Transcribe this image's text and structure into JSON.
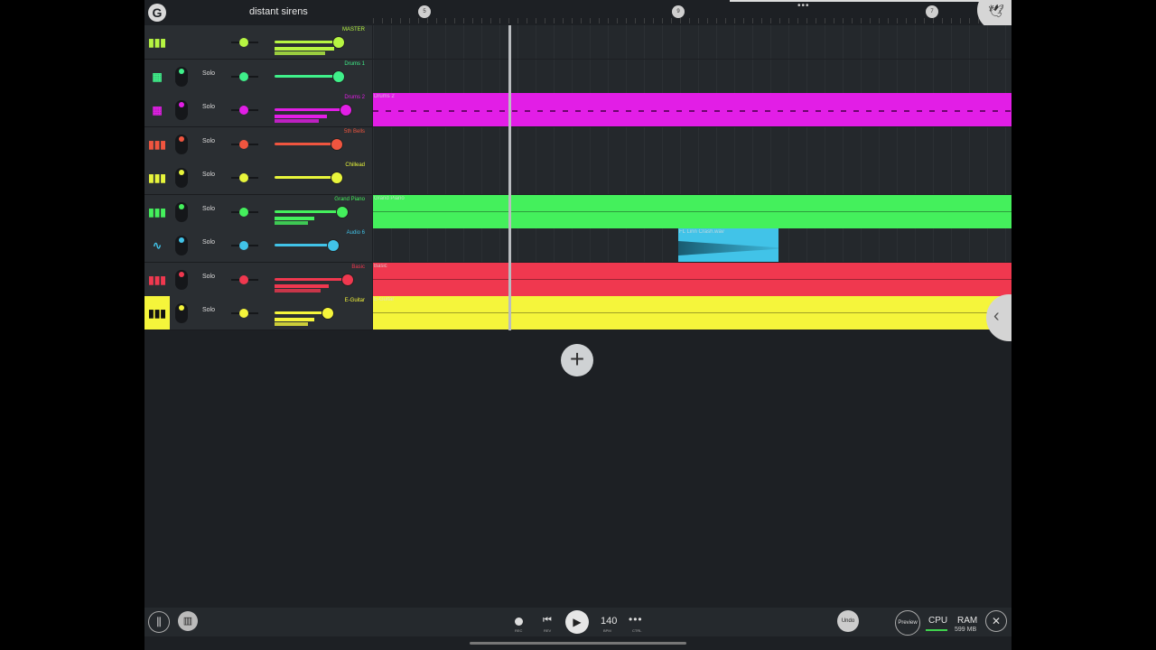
{
  "project": {
    "title": "distant sirens"
  },
  "ruler": {
    "markers": [
      "5",
      "9",
      "7"
    ],
    "more": "•••"
  },
  "tracks": [
    {
      "name": "MASTER",
      "solo": "",
      "color": "#b6f542",
      "icon": "mixer-bars-icon",
      "glyph": "▮▮▮",
      "volume": 0.88,
      "meter": 0.82
    },
    {
      "name": "Drums 1",
      "solo": "Solo",
      "color": "#3ff08a",
      "icon": "drum-grid-icon",
      "glyph": "▦",
      "volume": 0.88,
      "meter": 0.0
    },
    {
      "name": "Drums 2",
      "solo": "Solo",
      "color": "#e21ee6",
      "icon": "drum-grid-icon",
      "glyph": "▦",
      "volume": 0.98,
      "meter": 0.72
    },
    {
      "name": "5th Bells",
      "solo": "Solo",
      "color": "#f0553f",
      "icon": "keys-icon",
      "glyph": "▮▮▮",
      "volume": 0.85,
      "meter": 0.0
    },
    {
      "name": "Chillead",
      "solo": "Solo",
      "color": "#e8f53b",
      "icon": "keys-icon",
      "glyph": "▮▮▮",
      "volume": 0.85,
      "meter": 0.0
    },
    {
      "name": "Grand Piano",
      "solo": "Solo",
      "color": "#44f05c",
      "icon": "keys-icon",
      "glyph": "▮▮▮",
      "volume": 0.93,
      "meter": 0.55
    },
    {
      "name": "Audio 6",
      "solo": "Solo",
      "color": "#41c3e8",
      "icon": "waveform-icon",
      "glyph": "∿",
      "volume": 0.8,
      "meter": 0.0
    },
    {
      "name": "Basic",
      "solo": "Solo",
      "color": "#f0384f",
      "icon": "keys-icon",
      "glyph": "▮▮▮",
      "volume": 1.0,
      "meter": 0.75
    },
    {
      "name": "E-Guitar",
      "solo": "Solo",
      "color": "#f5f53b",
      "icon": "piano-icon",
      "glyph": "▮▮▮",
      "volume": 0.73,
      "meter": 0.55
    }
  ],
  "clips": [
    {
      "track": 2,
      "label": "Drums 2",
      "color": "#e21ee6",
      "start": 0.0,
      "end": 1.0
    },
    {
      "track": 5,
      "label": "Grand Piano",
      "color": "#44f05c",
      "start": 0.0,
      "end": 1.0
    },
    {
      "track": 6,
      "label": "FL Linn Crash.wav",
      "color": "#41c3e8",
      "start": 0.478,
      "end": 0.635
    },
    {
      "track": 7,
      "label": "Basic",
      "color": "#f0384f",
      "start": 0.0,
      "end": 1.0
    },
    {
      "track": 8,
      "label": "E-Guitar",
      "color": "#f5f53b",
      "start": 0.0,
      "end": 1.0
    }
  ],
  "transport": {
    "rec_label": "REC",
    "rev_label": "REV",
    "bpm": "140",
    "bpm_label": "BPM",
    "ctrl_label": "CTRL",
    "undo": "Undo",
    "preview": "Preview",
    "cpu": "CPU",
    "ram": "RAM",
    "ram_value": "599 MB"
  },
  "colors": {
    "background": "#1d2024",
    "track_header": "#2a2e32",
    "playhead": "#b9bcbf"
  }
}
